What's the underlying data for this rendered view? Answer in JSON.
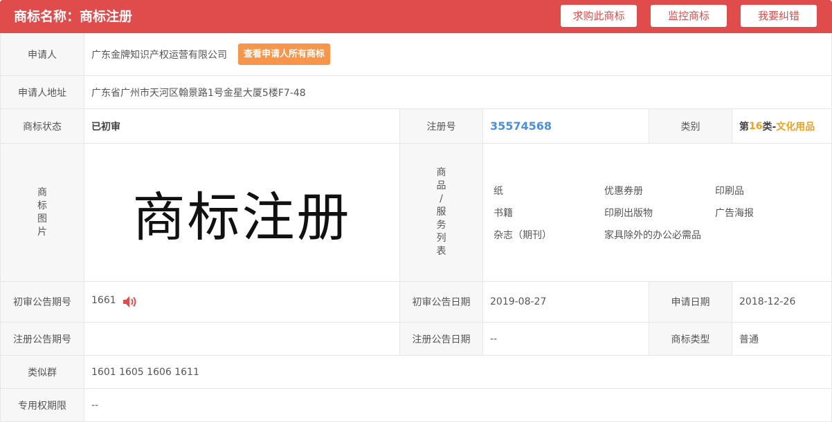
{
  "header": {
    "title": "商标名称：商标注册",
    "buttons": [
      "求购此商标",
      "监控商标",
      "我要纠错"
    ]
  },
  "applicant": {
    "label": "申请人",
    "value": "广东金牌知识产权运营有限公司",
    "view_all_button": "查看申请人所有商标"
  },
  "address": {
    "label": "申请人地址",
    "value": "广东省广州市天河区翰景路1号金星大厦5楼F7-48"
  },
  "status": {
    "label": "商标状态",
    "value": "已初审",
    "reg_no_label": "注册号",
    "reg_no": "35574568",
    "category_label": "类别",
    "category_prefix": "第",
    "category_num": "16",
    "category_suffix": "类-",
    "category_name": "文化用品"
  },
  "image": {
    "label_chars": [
      "商",
      "标",
      "图",
      "片"
    ],
    "mark_text": "商标注册",
    "goods_label_chars": [
      "商",
      "品",
      "/",
      "服",
      "务",
      "列",
      "表"
    ],
    "goods": [
      "纸",
      "优惠券册",
      "印刷品",
      "书籍",
      "印刷出版物",
      "广告海报",
      "杂志（期刊）",
      "家具除外的办公必需品"
    ]
  },
  "prelim": {
    "issue_label": "初审公告期号",
    "issue_value": "1661",
    "date_label": "初审公告日期",
    "date_value": "2019-08-27",
    "apply_label": "申请日期",
    "apply_value": "2018-12-26"
  },
  "registration": {
    "issue_label": "注册公告期号",
    "issue_value": "",
    "date_label": "注册公告日期",
    "date_value": "--",
    "type_label": "商标类型",
    "type_value": "普通"
  },
  "similar": {
    "label": "类似群",
    "value": "1601 1605 1606 1611"
  },
  "exclusive": {
    "label": "专用权期限",
    "value": "--"
  },
  "colors": {
    "header_bg": "#e04b4b",
    "orange_button": "#f7954a",
    "link_blue": "#4a90e2",
    "category_orange": "#f0a01e"
  }
}
